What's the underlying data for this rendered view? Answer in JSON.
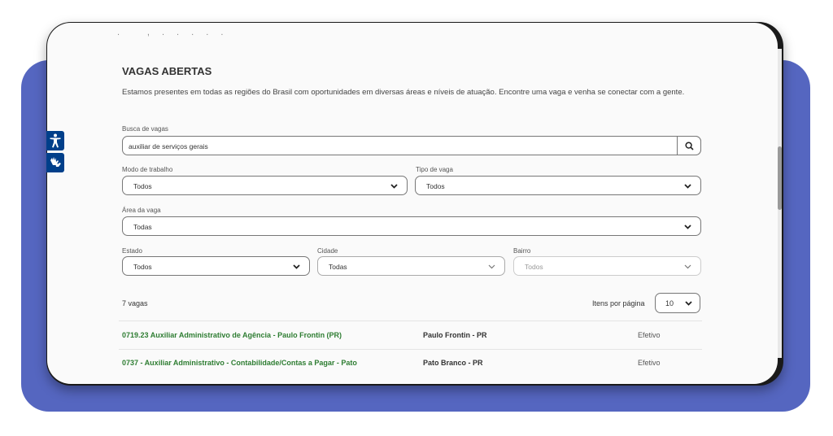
{
  "section": {
    "title": "VAGAS ABERTAS",
    "description": "Estamos presentes em todas as regiões do Brasil com oportunidades em diversas áreas e níveis de atuação. Encontre uma vaga e venha se conectar com a gente."
  },
  "search": {
    "label": "Busca de vagas",
    "value": "auxiliar de serviços gerais"
  },
  "filters": {
    "modo": {
      "label": "Modo de trabalho",
      "value": "Todos"
    },
    "tipo": {
      "label": "Tipo de vaga",
      "value": "Todos"
    },
    "area": {
      "label": "Área da vaga",
      "value": "Todas"
    },
    "estado": {
      "label": "Estado",
      "value": "Todos"
    },
    "cidade": {
      "label": "Cidade",
      "value": "Todas"
    },
    "bairro": {
      "label": "Bairro",
      "value": "Todos"
    }
  },
  "results": {
    "count": "7 vagas",
    "per_page_label": "Itens por página",
    "per_page_value": "10",
    "jobs": [
      {
        "title": "0719.23 Auxiliar Administrativo de Agência - Paulo Frontin (PR)",
        "location": "Paulo Frontin - PR",
        "type": "Efetivo"
      },
      {
        "title": "0737 - Auxiliar Administrativo - Contabilidade/Contas a Pagar - Pato",
        "location": "Pato Branco - PR",
        "type": "Efetivo"
      }
    ]
  },
  "accessibility": {
    "buttons": [
      "accessibility-person-icon",
      "sign-language-icon"
    ]
  },
  "colors": {
    "backdrop": "#5566c0",
    "job_link": "#2e7d32",
    "a11y": "#003f8a"
  }
}
